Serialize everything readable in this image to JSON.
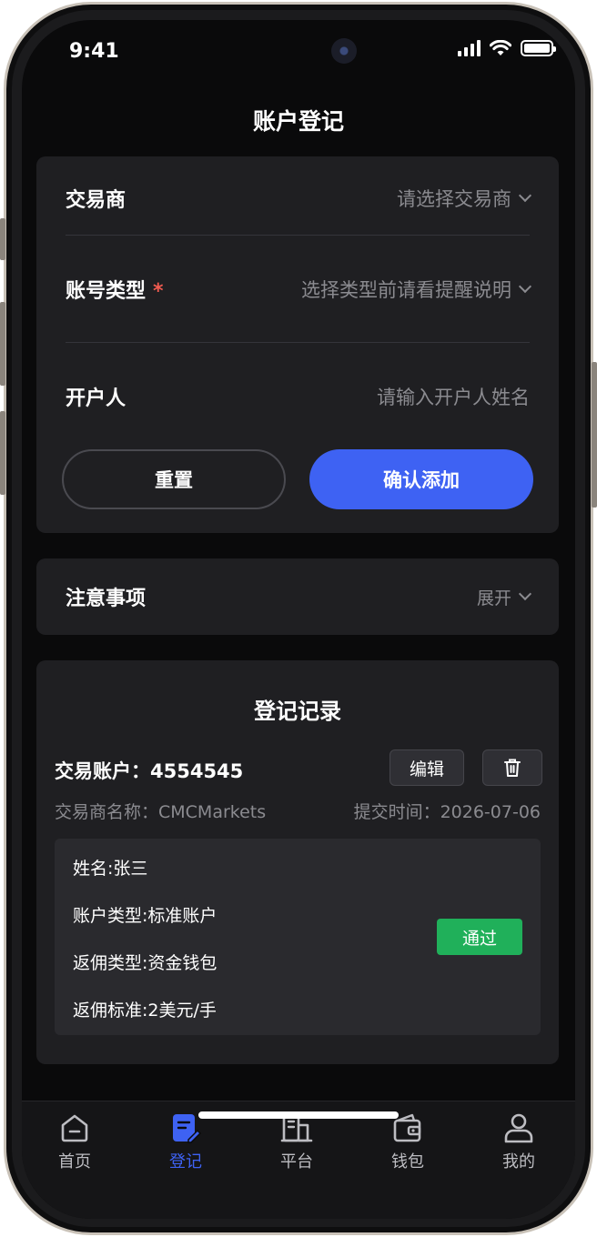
{
  "status_bar": {
    "time": "9:41"
  },
  "header": {
    "title": "账户登记"
  },
  "form": {
    "broker": {
      "label": "交易商",
      "placeholder": "请选择交易商"
    },
    "account_type": {
      "label": "账号类型",
      "required_mark": "*",
      "placeholder": "选择类型前请看提醒说明"
    },
    "holder": {
      "label": "开户人",
      "placeholder": "请输入开户人姓名"
    },
    "reset_label": "重置",
    "confirm_label": "确认添加"
  },
  "notice": {
    "label": "注意事项",
    "toggle_label": "展开"
  },
  "records": {
    "title": "登记记录",
    "items": [
      {
        "account_label": "交易账户：",
        "account_no": "4554545",
        "edit_label": "编辑",
        "broker_name": "交易商名称：CMCMarkets",
        "submit_time": "提交时间：2026-07-06",
        "name": "姓名:张三",
        "account_type": "账户类型:标准账户",
        "rebate_type": "返佣类型:资金钱包",
        "rebate_standard": "返佣标准:2美元/手",
        "status": "通过"
      }
    ]
  },
  "tabbar": {
    "items": [
      {
        "label": "首页",
        "icon": "home-icon"
      },
      {
        "label": "登记",
        "icon": "register-icon"
      },
      {
        "label": "平台",
        "icon": "platform-icon"
      },
      {
        "label": "钱包",
        "icon": "wallet-icon"
      },
      {
        "label": "我的",
        "icon": "profile-icon"
      }
    ],
    "active_index": 1
  },
  "colors": {
    "accent": "#3e62f3",
    "success": "#20b05a",
    "required": "#f15b50",
    "background": "#0a0a0b",
    "card": "#1f1f22"
  }
}
